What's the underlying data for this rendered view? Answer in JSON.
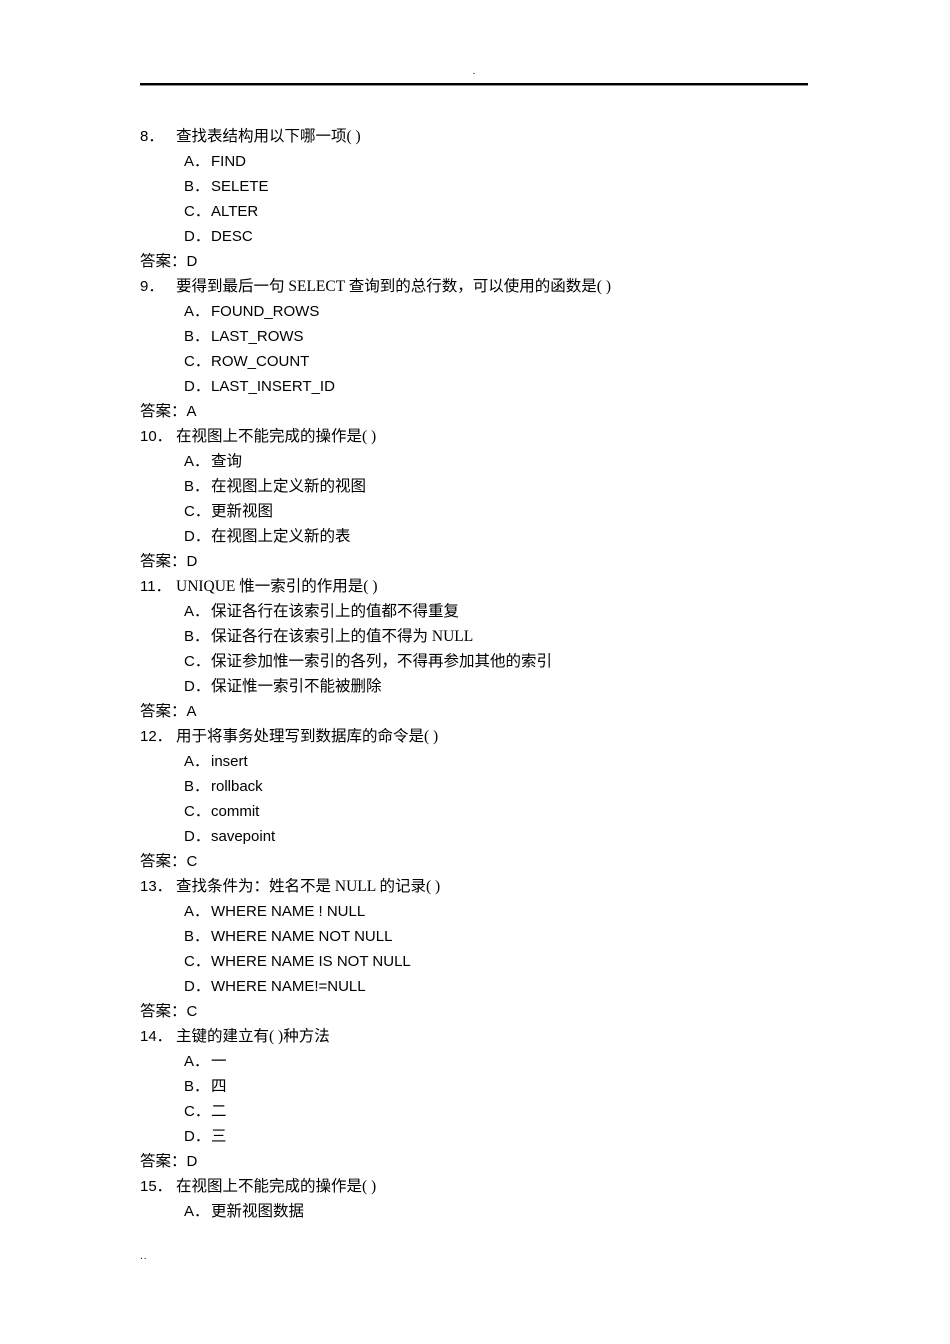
{
  "header": {
    "mark": "."
  },
  "footer": {
    "mark": ".."
  },
  "questions": [
    {
      "number": "8．",
      "stem": "查找表结构用以下哪一项(    )",
      "script": "latin",
      "options": [
        {
          "letter": "A．",
          "text": "FIND"
        },
        {
          "letter": "B．",
          "text": "SELETE"
        },
        {
          "letter": "C．",
          "text": "ALTER"
        },
        {
          "letter": "D．",
          "text": "DESC"
        }
      ],
      "answer_label": "答案：",
      "answer_value": "D"
    },
    {
      "number": "9．",
      "stem": "要得到最后一句 SELECT 查询到的总行数，可以使用的函数是(    )",
      "script": "latin",
      "options": [
        {
          "letter": "A．",
          "text": "FOUND_ROWS"
        },
        {
          "letter": "B．",
          "text": "LAST_ROWS"
        },
        {
          "letter": "C．",
          "text": "ROW_COUNT"
        },
        {
          "letter": "D．",
          "text": "LAST_INSERT_ID"
        }
      ],
      "answer_label": "答案：",
      "answer_value": "A"
    },
    {
      "number": "10．",
      "stem": "在视图上不能完成的操作是(    )",
      "script": "cjk",
      "options": [
        {
          "letter": "A．",
          "text": "查询"
        },
        {
          "letter": "B．",
          "text": "在视图上定义新的视图"
        },
        {
          "letter": "C．",
          "text": "更新视图"
        },
        {
          "letter": "D．",
          "text": "在视图上定义新的表"
        }
      ],
      "answer_label": "答案：",
      "answer_value": "D"
    },
    {
      "number": "11．",
      "stem": "UNIQUE 惟一索引的作用是(    )",
      "script": "cjk",
      "options": [
        {
          "letter": "A．",
          "text": "保证各行在该索引上的值都不得重复"
        },
        {
          "letter": "B．",
          "text": "保证各行在该索引上的值不得为 NULL"
        },
        {
          "letter": "C．",
          "text": "保证参加惟一索引的各列，不得再参加其他的索引"
        },
        {
          "letter": "D．",
          "text": "保证惟一索引不能被删除"
        }
      ],
      "answer_label": "答案：",
      "answer_value": "A"
    },
    {
      "number": "12．",
      "stem": "用于将事务处理写到数据库的命令是(    )",
      "script": "latin",
      "options": [
        {
          "letter": "A．",
          "text": "insert"
        },
        {
          "letter": "B．",
          "text": "rollback"
        },
        {
          "letter": "C．",
          "text": "commit"
        },
        {
          "letter": "D．",
          "text": "savepoint"
        }
      ],
      "answer_label": "答案：",
      "answer_value": "C"
    },
    {
      "number": "13．",
      "stem": "查找条件为：姓名不是 NULL 的记录(    )",
      "script": "latin",
      "options": [
        {
          "letter": "A．",
          "text": "WHERE NAME ! NULL"
        },
        {
          "letter": "B．",
          "text": "WHERE NAME NOT NULL"
        },
        {
          "letter": "C．",
          "text": "WHERE NAME IS NOT NULL"
        },
        {
          "letter": "D．",
          "text": "WHERE NAME!=NULL"
        }
      ],
      "answer_label": "答案：",
      "answer_value": "C"
    },
    {
      "number": "14．",
      "stem": "主键的建立有(    )种方法",
      "script": "cjk",
      "options": [
        {
          "letter": "A．",
          "text": "一"
        },
        {
          "letter": "B．",
          "text": "四"
        },
        {
          "letter": "C．",
          "text": "二"
        },
        {
          "letter": "D．",
          "text": "三"
        }
      ],
      "answer_label": "答案：",
      "answer_value": "D"
    },
    {
      "number": "15．",
      "stem": "在视图上不能完成的操作是(    )",
      "script": "cjk",
      "options": [
        {
          "letter": "A．",
          "text": "更新视图数据"
        }
      ],
      "answer_label": "",
      "answer_value": ""
    }
  ]
}
